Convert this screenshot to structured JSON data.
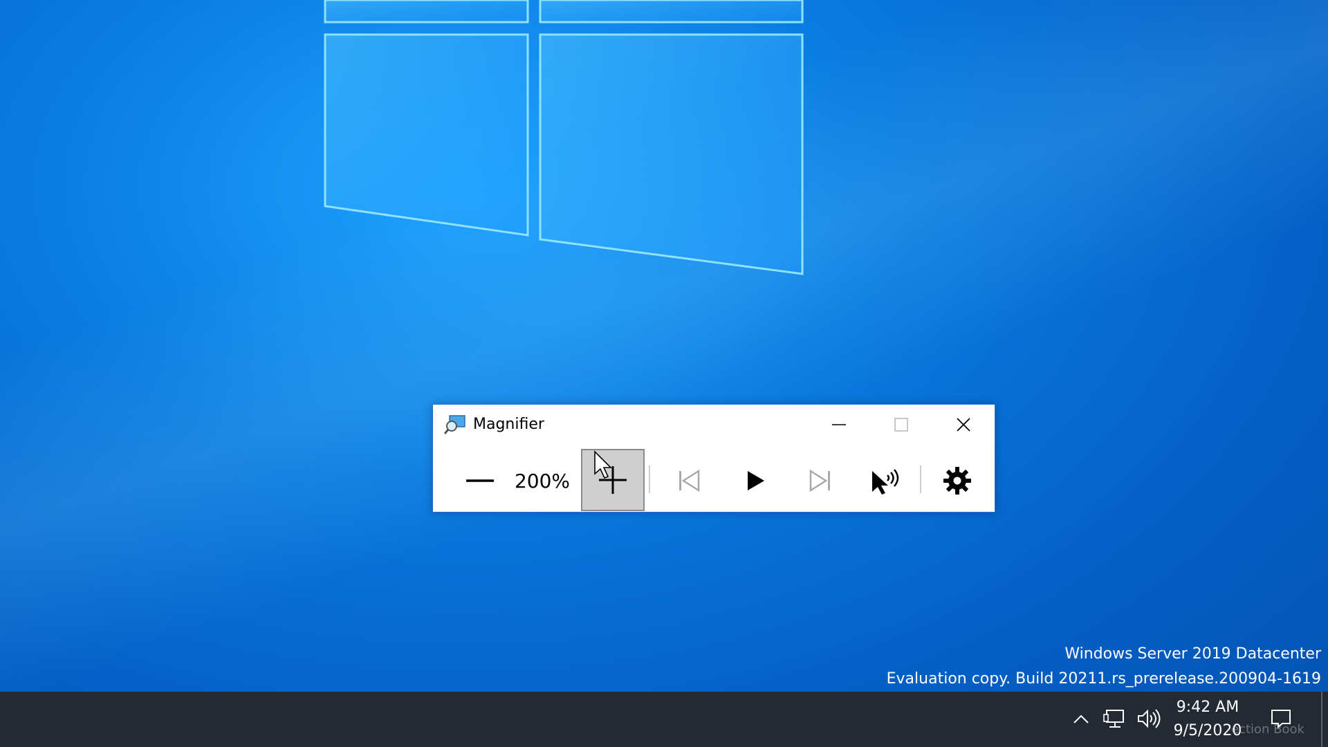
{
  "desktop": {
    "watermark_line1": "Windows Server 2019 Datacenter",
    "watermark_line2": "Evaluation copy. Build 20211.rs_prerelease.200904-1619"
  },
  "magnifier": {
    "title": "Magnifier",
    "zoom_level": "200%",
    "icons": {
      "app": "magnifier-app-icon",
      "minimize": "minimize-icon",
      "maximize": "maximize-icon",
      "close": "close-icon",
      "zoom_out": "minus-icon",
      "zoom_in": "plus-icon",
      "previous": "skip-previous-icon",
      "play": "play-icon",
      "next": "skip-next-icon",
      "read_from_here": "pointer-speaker-icon",
      "settings": "gear-icon"
    }
  },
  "taskbar": {
    "time": "9:42 AM",
    "date": "9/5/2020",
    "faint_overlay_text": "ection Book"
  },
  "colors": {
    "taskbar_bg": "#232a33",
    "desktop_blue": "#0a7be0",
    "zoom_in_active_bg": "#cfcfcf"
  }
}
